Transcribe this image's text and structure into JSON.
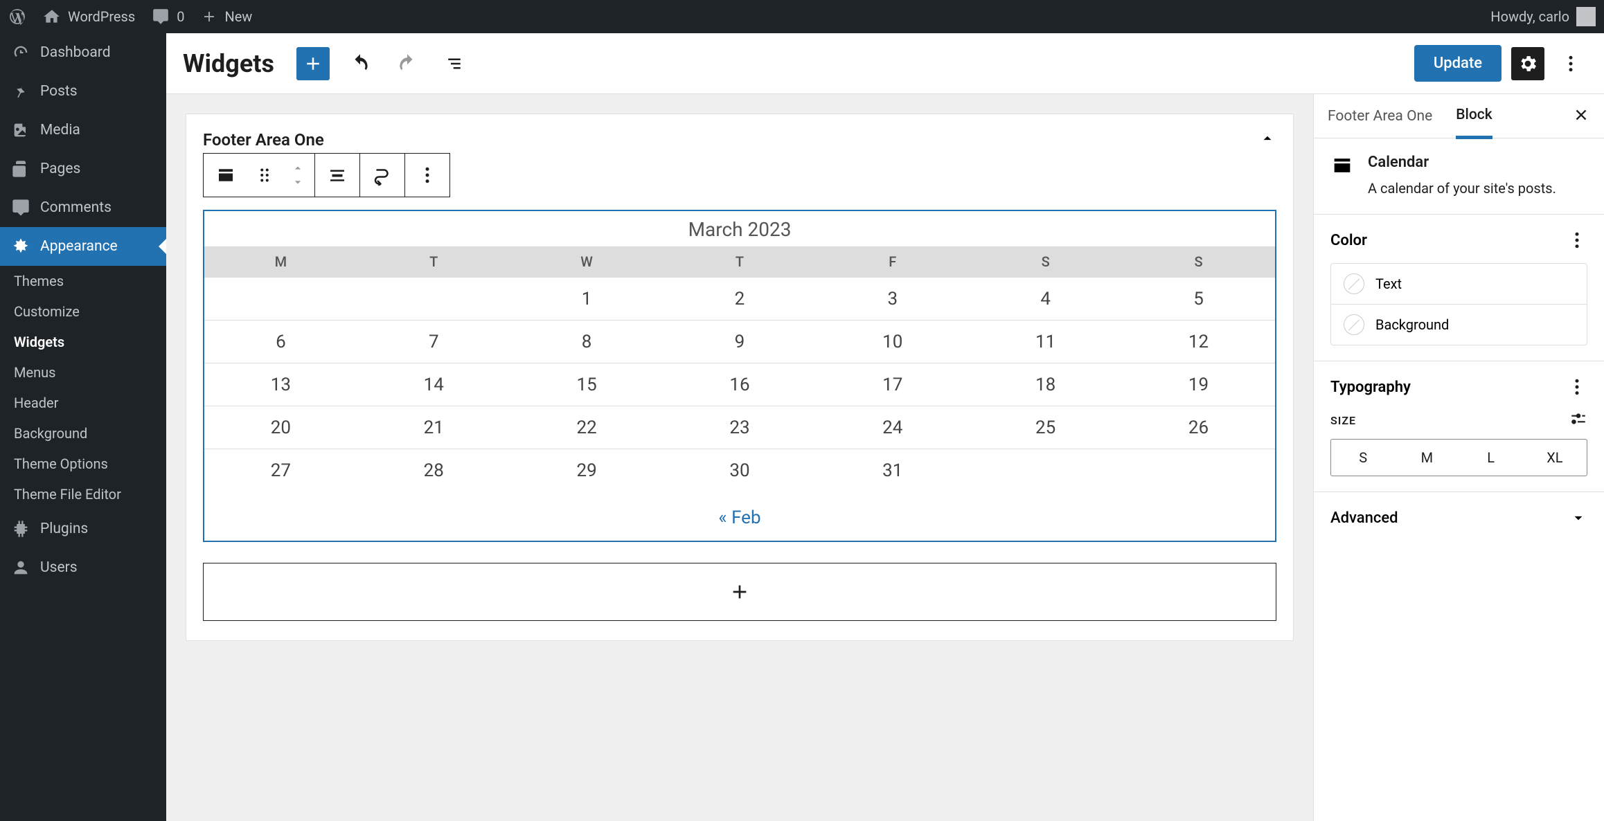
{
  "adminbar": {
    "site_name": "WordPress",
    "comments_count": "0",
    "new_label": "New",
    "howdy": "Howdy, carlo"
  },
  "sidebar": {
    "items": [
      {
        "id": "dashboard",
        "label": "Dashboard"
      },
      {
        "id": "posts",
        "label": "Posts"
      },
      {
        "id": "media",
        "label": "Media"
      },
      {
        "id": "pages",
        "label": "Pages"
      },
      {
        "id": "comments",
        "label": "Comments"
      },
      {
        "id": "appearance",
        "label": "Appearance"
      },
      {
        "id": "plugins",
        "label": "Plugins"
      },
      {
        "id": "users",
        "label": "Users"
      }
    ],
    "submenu": [
      {
        "label": "Themes"
      },
      {
        "label": "Customize"
      },
      {
        "label": "Widgets"
      },
      {
        "label": "Menus"
      },
      {
        "label": "Header"
      },
      {
        "label": "Background"
      },
      {
        "label": "Theme Options"
      },
      {
        "label": "Theme File Editor"
      }
    ]
  },
  "header": {
    "title": "Widgets",
    "update": "Update"
  },
  "widget_area": {
    "title": "Footer Area One"
  },
  "calendar": {
    "caption": "March 2023",
    "weekdays": [
      "M",
      "T",
      "W",
      "T",
      "F",
      "S",
      "S"
    ],
    "rows": [
      [
        "",
        "",
        "1",
        "2",
        "3",
        "4",
        "5"
      ],
      [
        "6",
        "7",
        "8",
        "9",
        "10",
        "11",
        "12"
      ],
      [
        "13",
        "14",
        "15",
        "16",
        "17",
        "18",
        "19"
      ],
      [
        "20",
        "21",
        "22",
        "23",
        "24",
        "25",
        "26"
      ],
      [
        "27",
        "28",
        "29",
        "30",
        "31",
        "",
        ""
      ]
    ],
    "prev": "« Feb"
  },
  "inspector": {
    "tab_area": "Footer Area One",
    "tab_block": "Block",
    "block_title": "Calendar",
    "block_desc": "A calendar of your site's posts.",
    "color": {
      "title": "Color",
      "text": "Text",
      "background": "Background"
    },
    "typography": {
      "title": "Typography",
      "size_label": "Size",
      "sizes": [
        "S",
        "M",
        "L",
        "XL"
      ]
    },
    "advanced": "Advanced"
  }
}
